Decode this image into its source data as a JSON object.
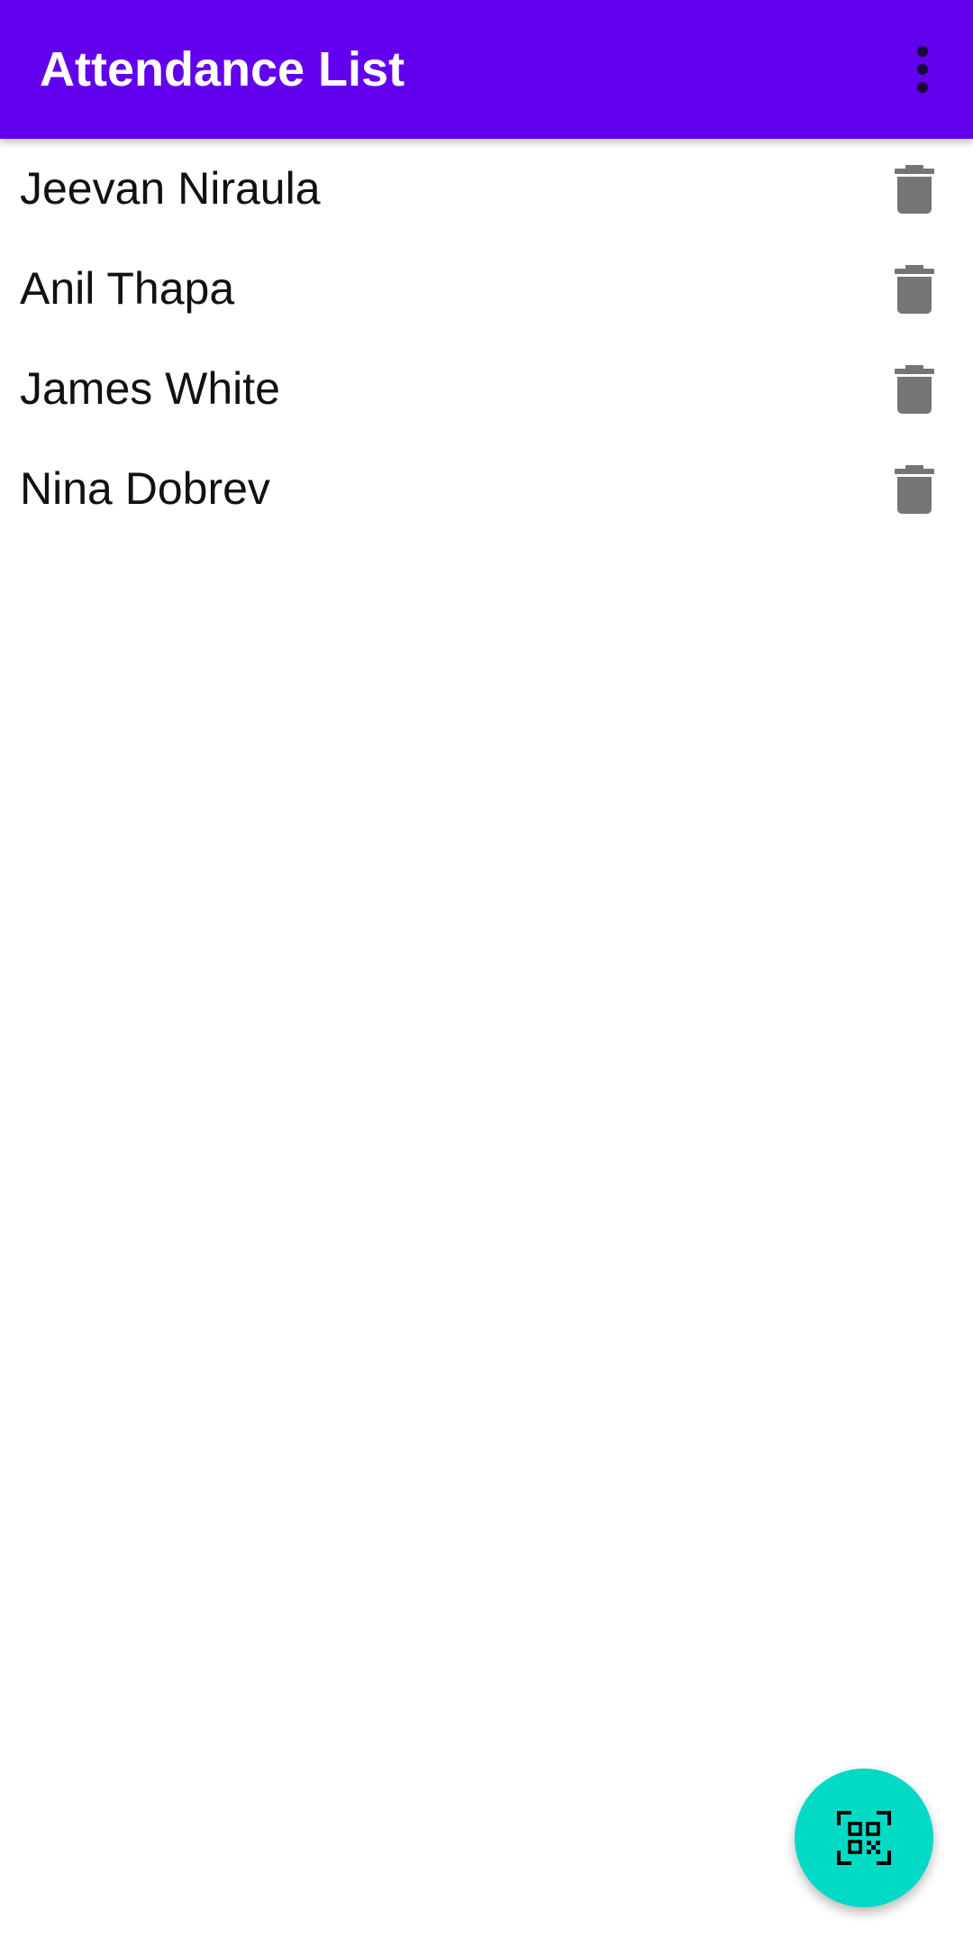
{
  "app_bar": {
    "title": "Attendance List",
    "background_color": "#6200EE",
    "overflow_icon": "more-vert-icon"
  },
  "attendance": {
    "items": [
      {
        "name": "Jeevan Niraula",
        "action_icon": "delete-icon"
      },
      {
        "name": "Anil Thapa",
        "action_icon": "delete-icon"
      },
      {
        "name": "James White",
        "action_icon": "delete-icon"
      },
      {
        "name": "Nina Dobrev",
        "action_icon": "delete-icon"
      }
    ]
  },
  "fab": {
    "icon": "qr-code-scanner-icon",
    "color": "#03DAC5"
  }
}
